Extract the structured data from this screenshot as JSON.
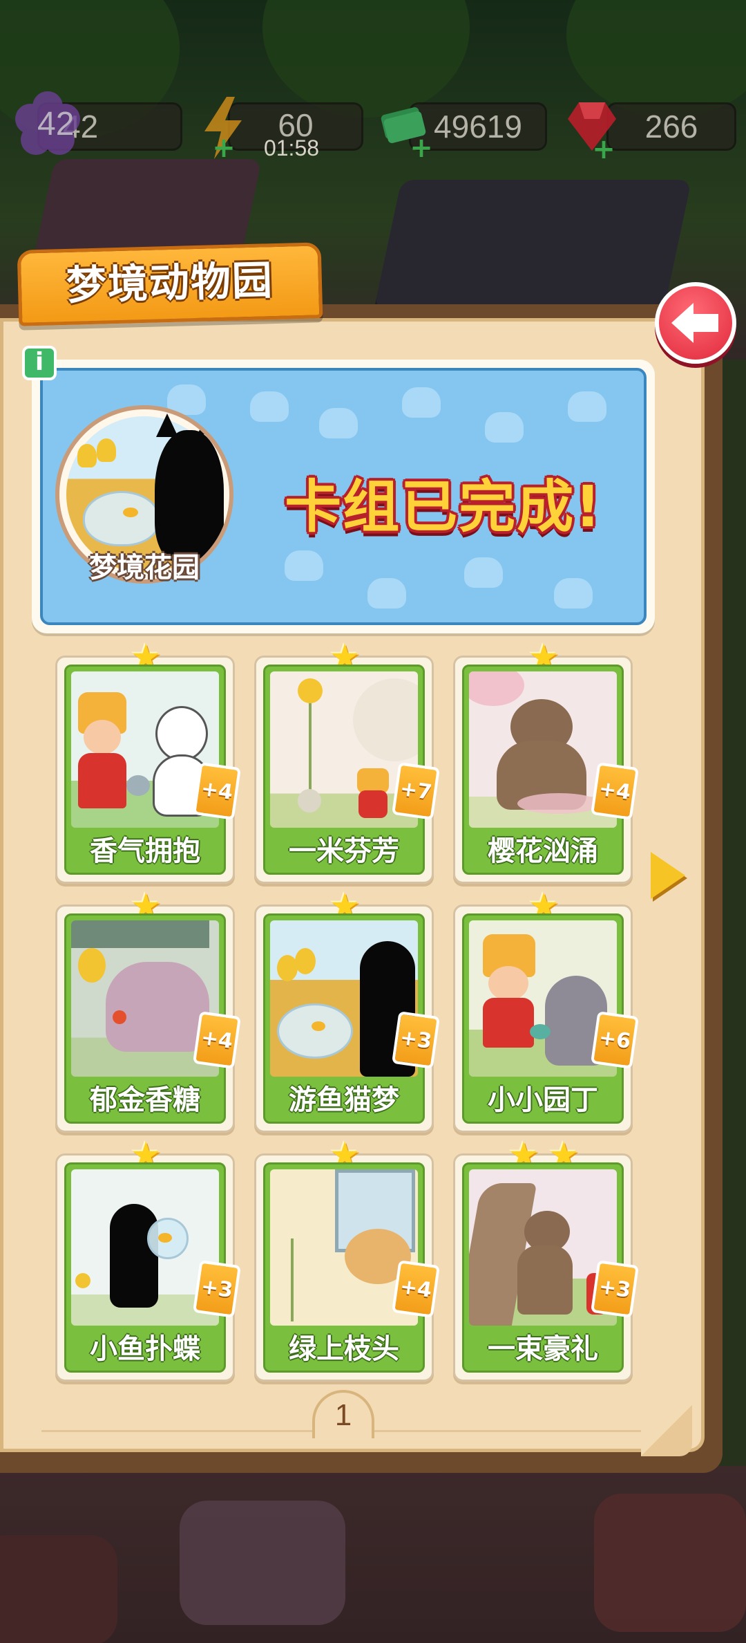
{
  "resources": {
    "level": "42",
    "energy": "60",
    "energy_timer": "01:58",
    "cash": "49619",
    "gems": "266"
  },
  "album": {
    "title": "梦境动物园",
    "banner": {
      "medal_label": "梦境花园",
      "status_text": "卡组已完成!"
    },
    "cards": [
      {
        "name": "香气拥抱",
        "badge": "+4",
        "stars": 1
      },
      {
        "name": "一米芬芳",
        "badge": "+7",
        "stars": 1
      },
      {
        "name": "樱花汹涌",
        "badge": "+4",
        "stars": 1
      },
      {
        "name": "郁金香糖",
        "badge": "+4",
        "stars": 1
      },
      {
        "name": "游鱼猫梦",
        "badge": "+3",
        "stars": 1
      },
      {
        "name": "小小园丁",
        "badge": "+6",
        "stars": 1
      },
      {
        "name": "小鱼扑蝶",
        "badge": "+3",
        "stars": 1
      },
      {
        "name": "绿上枝头",
        "badge": "+4",
        "stars": 1
      },
      {
        "name": "一束豪礼",
        "badge": "+3",
        "stars": 2
      }
    ],
    "page_number": "1"
  },
  "colors": {
    "accent_orange": "#f39a16",
    "card_green": "#7bbf3f",
    "banner_blue": "#84c6ef",
    "back_red": "#e0283c",
    "star_yellow": "#ffd21e"
  },
  "icons": [
    "level-flower-icon",
    "energy-bolt-icon",
    "cash-icon",
    "gem-icon",
    "back-arrow-icon",
    "info-icon",
    "star-icon",
    "next-page-arrow-icon"
  ]
}
